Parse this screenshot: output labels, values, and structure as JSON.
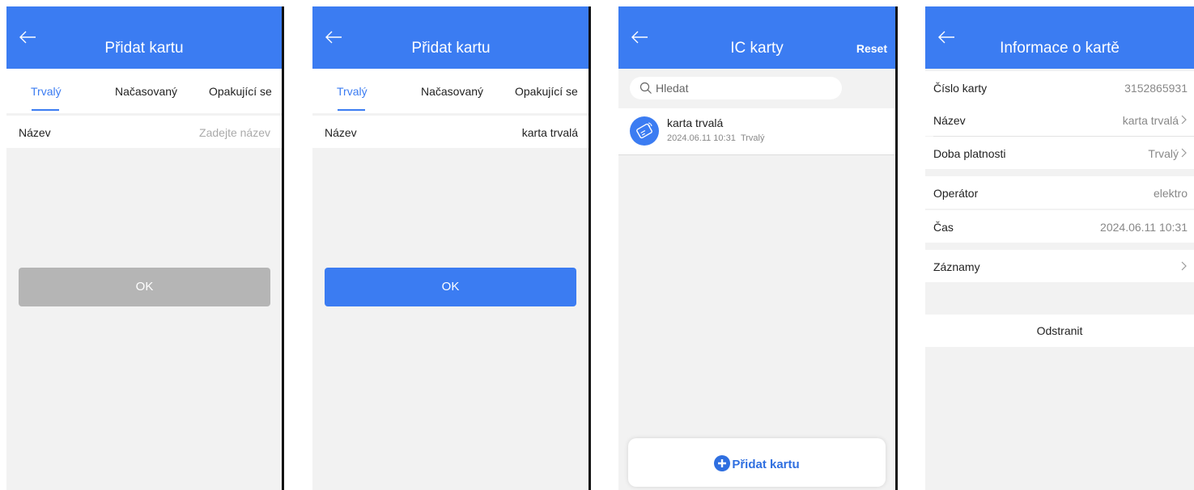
{
  "colors": {
    "accent": "#3b7cf2",
    "background": "#f2f2f2",
    "disabled": "#b5b5b5"
  },
  "screen1": {
    "title": "Přidat kartu",
    "tabs": [
      "Trvalý",
      "Načasovaný",
      "Opakující se"
    ],
    "name_label": "Název",
    "name_placeholder": "Zadejte název",
    "ok_label": "OK"
  },
  "screen2": {
    "title": "Přidat kartu",
    "tabs": [
      "Trvalý",
      "Načasovaný",
      "Opakující se"
    ],
    "name_label": "Název",
    "name_value": "karta trvalá",
    "ok_label": "OK"
  },
  "screen3": {
    "title": "IC karty",
    "reset_label": "Reset",
    "search_placeholder": "Hledat",
    "card": {
      "name": "karta trvalá",
      "date": "2024.06.11 10:31",
      "type": "Trvalý"
    },
    "add_label": "Přidat kartu"
  },
  "screen4": {
    "title": "Informace o kartě",
    "card_number_label": "Číslo karty",
    "card_number_value": "3152865931",
    "name_label": "Název",
    "name_value": "karta trvalá",
    "validity_label": "Doba platnosti",
    "validity_value": "Trvalý",
    "operator_label": "Operátor",
    "operator_value": "elektro",
    "time_label": "Čas",
    "time_value": "2024.06.11 10:31",
    "records_label": "Záznamy",
    "delete_label": "Odstranit"
  },
  "icons": [
    "back-arrow-icon",
    "search-icon",
    "card-icon",
    "plus-circle-icon",
    "chevron-right-icon"
  ]
}
